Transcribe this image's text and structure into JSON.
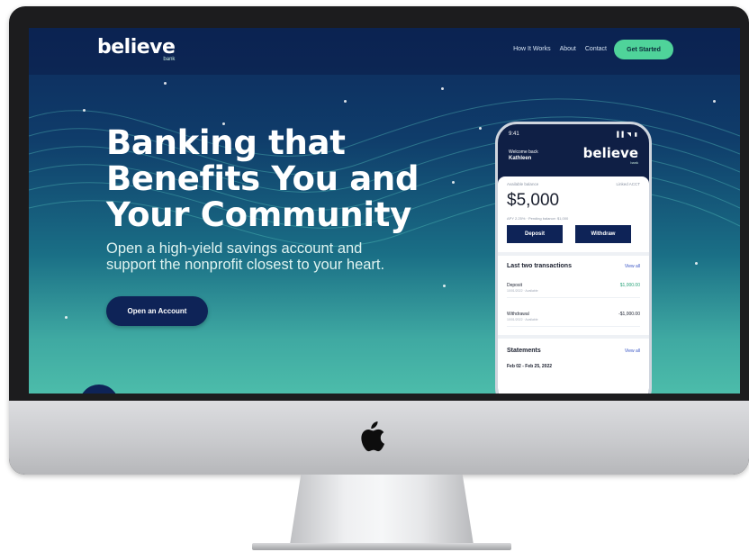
{
  "nav": {
    "logo_word": "believe",
    "logo_sub": "bank",
    "links": [
      "How It Works",
      "About",
      "Contact"
    ],
    "cta": "Get Started"
  },
  "hero": {
    "title_lines": [
      "Banking that",
      "Benefits You and",
      "Your Community"
    ],
    "subtitle_lines": [
      "Open a high-yield savings account and",
      "support the nonprofit closest to your heart."
    ],
    "button": "Open an Account"
  },
  "phone": {
    "time": "9:41",
    "signal": "▐▐ ◥ ▮",
    "greeting": "Welcome back",
    "name": "Kathleen",
    "logo_word": "believe",
    "logo_sub": "bank",
    "account_label": "Available balance",
    "account_switch": "Linked ACCT",
    "balance": "$5,000",
    "apy_line": "APY 2.25% · Pending balance: $1,000",
    "deposit_label": "Deposit",
    "withdraw_label": "Withdraw",
    "transactions_title": "Last two transactions",
    "view_all": "View all",
    "transactions": [
      {
        "type": "Deposit",
        "date": "10/01/2022 · Available",
        "amount": "$1,000.00"
      },
      {
        "type": "Withdrawal",
        "date": "10/01/2022 · Available",
        "amount": "-$1,000.00"
      }
    ],
    "statements_title": "Statements",
    "statements_view_all": "View all",
    "statement_item": "Feb 02 - Feb 25, 2022"
  },
  "colors": {
    "navy": "#0e2357",
    "accent_green": "#4fd39a",
    "teal": "#4cbcaa"
  }
}
